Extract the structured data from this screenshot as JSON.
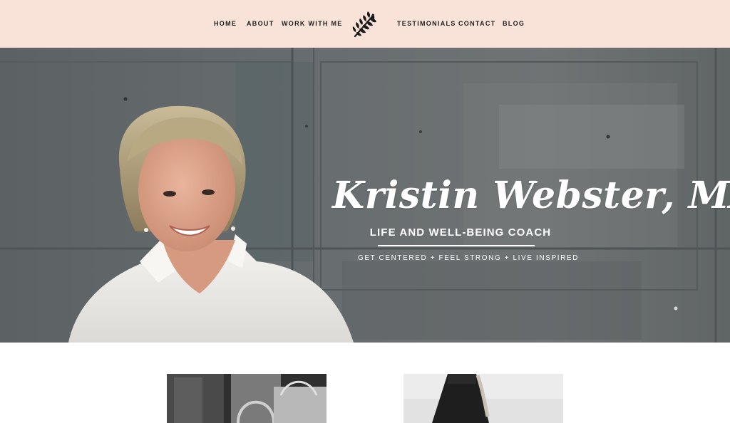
{
  "nav": {
    "left": [
      "HOME",
      "ABOUT",
      "WORK WITH ME"
    ],
    "right": [
      "TESTIMONIALS",
      "CONTACT",
      "BLOG"
    ],
    "logo_icon": "leaf-icon"
  },
  "hero": {
    "name": "Kristin Webster, MA",
    "title": "LIFE AND WELL-BEING COACH",
    "tagline": "GET CENTERED + FEEL STRONG + LIVE INSPIRED"
  },
  "colors": {
    "header_bg": "#f9e2d8",
    "nav_text": "#1f1f1f",
    "hero_wall": "#62676a",
    "hero_text": "#ffffff"
  }
}
